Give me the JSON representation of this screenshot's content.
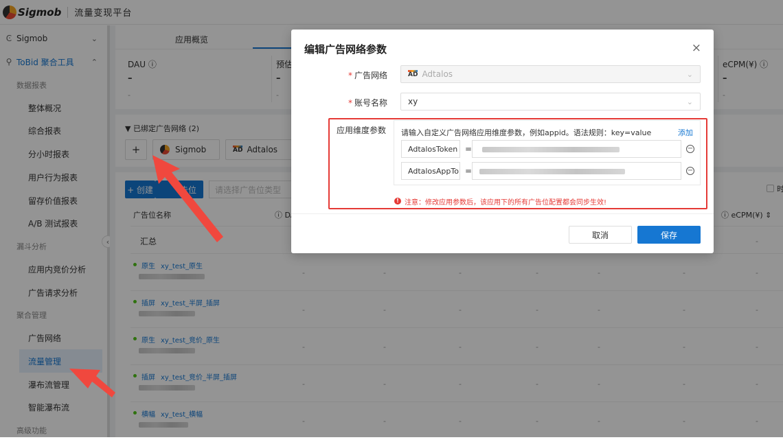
{
  "brand": {
    "logo_text": "Sigmob",
    "platform": "流量变现平台"
  },
  "sidebar": {
    "top_items": [
      {
        "label": "Sigmob",
        "icon": "sigmob-icon"
      },
      {
        "label": "ToBid 聚合工具",
        "icon": "tobid-icon"
      }
    ],
    "groups": [
      {
        "title": "数据报表",
        "items": [
          "整体概况",
          "综合报表",
          "分小时报表",
          "用户行为报表",
          "留存价值报表",
          "A/B 测试报表"
        ]
      },
      {
        "title": "漏斗分析",
        "items": [
          "应用内竞价分析",
          "广告请求分析"
        ]
      },
      {
        "title": "聚合管理",
        "items": [
          "广告网络",
          "流量管理",
          "瀑布流管理",
          "智能瀑布流"
        ]
      },
      {
        "title": "高级功能",
        "items": []
      }
    ],
    "active_item": "流量管理"
  },
  "main": {
    "tabs": [
      "应用概览"
    ],
    "stats": [
      {
        "label": "DAU ⓘ",
        "value": "–",
        "sub": "-"
      },
      {
        "label": "预估",
        "value": "–",
        "sub": "-"
      },
      {
        "label": "eCPM(¥) ⓘ",
        "value": "–",
        "sub": "-"
      }
    ],
    "bound_networks_title": "▼ 已绑定广告网络 (2)",
    "add_symbol": "+",
    "networks": [
      "Sigmob",
      "Adtalos"
    ],
    "create_button": "+ 创建",
    "create_button_tail": "告位",
    "select_placeholder": "请选择广告位类型",
    "right_checkbox_label": "时",
    "table": {
      "header_name": "广告位名称",
      "header_da": "ⓘ DA",
      "header_ecpm": "ⓘ eCPM(¥) ⇕",
      "summary_label": "汇总",
      "rows": [
        {
          "tag": "原生",
          "name": "xy_test_原生"
        },
        {
          "tag": "插屏",
          "name": "xy_test_半屏_插屏"
        },
        {
          "tag": "原生",
          "name": "xy_test_竞价_原生"
        },
        {
          "tag": "插屏",
          "name": "xy_test_竞价_半屏_插屏"
        },
        {
          "tag": "横幅",
          "name": "xy_test_横幅"
        }
      ],
      "dash": "-"
    }
  },
  "modal": {
    "title": "编辑广告网络参数",
    "close_icon": "×",
    "network_label": "广告网络",
    "network_value": "Adtalos",
    "network_logo_text": "AD",
    "account_label": "账号名称",
    "account_value": "xy",
    "param_label": "应用维度参数",
    "param_hint": "请输入自定义广告网络应用维度参数，例如appid。语法规则：key=value",
    "add_link": "添加",
    "params": [
      {
        "key": "AdtalosToken",
        "eq": "="
      },
      {
        "key": "AdtalosAppTo",
        "eq": "="
      }
    ],
    "warning": "注意：修改应用参数后，该应用下的所有广告位配置都会同步生效!",
    "cancel": "取消",
    "save": "保存"
  },
  "colors": {
    "primary": "#1677d2",
    "danger": "#e53935",
    "annotation_arrow": "#f0483e"
  }
}
